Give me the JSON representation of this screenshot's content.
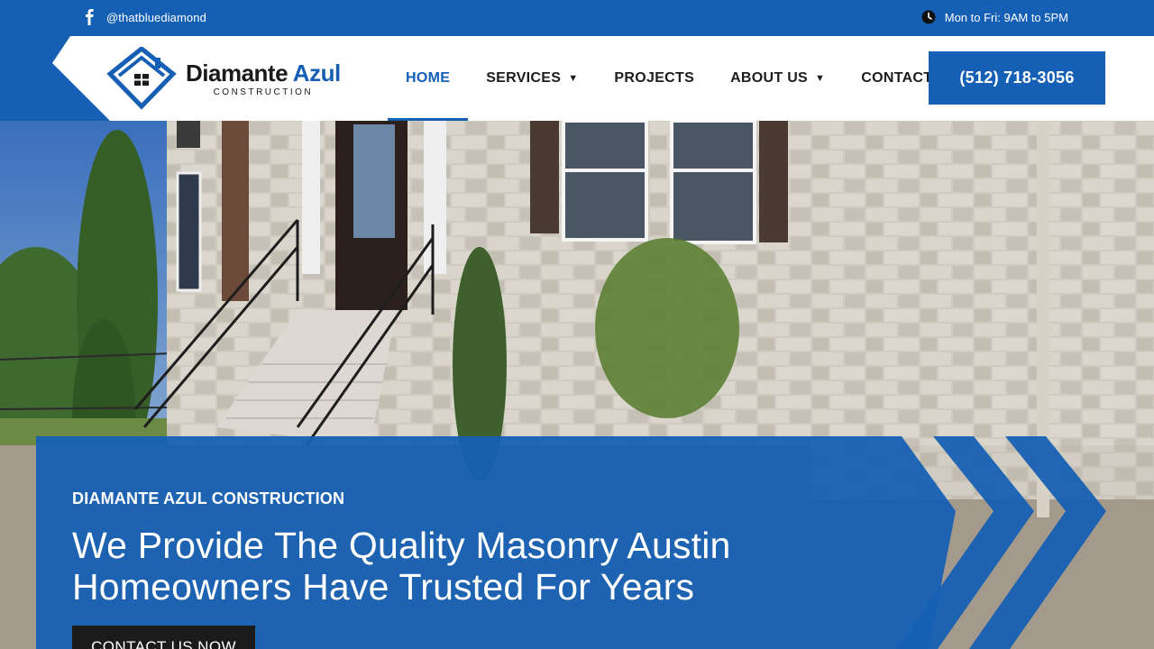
{
  "topbar": {
    "social_icon": "facebook-icon",
    "social_handle": "@thatbluediamond",
    "hours_icon": "clock-icon",
    "hours": "Mon to Fri: 9AM to 5PM"
  },
  "header": {
    "logo": {
      "brand_main": "Diamante ",
      "brand_accent": "Azul",
      "sub": "CONSTRUCTION"
    },
    "nav": {
      "home": "HOME",
      "services": "SERVICES",
      "projects": "PROJECTS",
      "about": "ABOUT US",
      "contact": "CONTACT US"
    },
    "phone": "(512) 718-3056"
  },
  "hero": {
    "eyebrow": "DIAMANTE AZUL CONSTRUCTION",
    "headline": "We Provide The Quality Masonry Austin Homeowners Have Trusted For Years",
    "cta": "CONTACT US NOW"
  },
  "colors": {
    "primary": "#1560b4",
    "dark": "#1b1b1b",
    "white": "#ffffff"
  }
}
